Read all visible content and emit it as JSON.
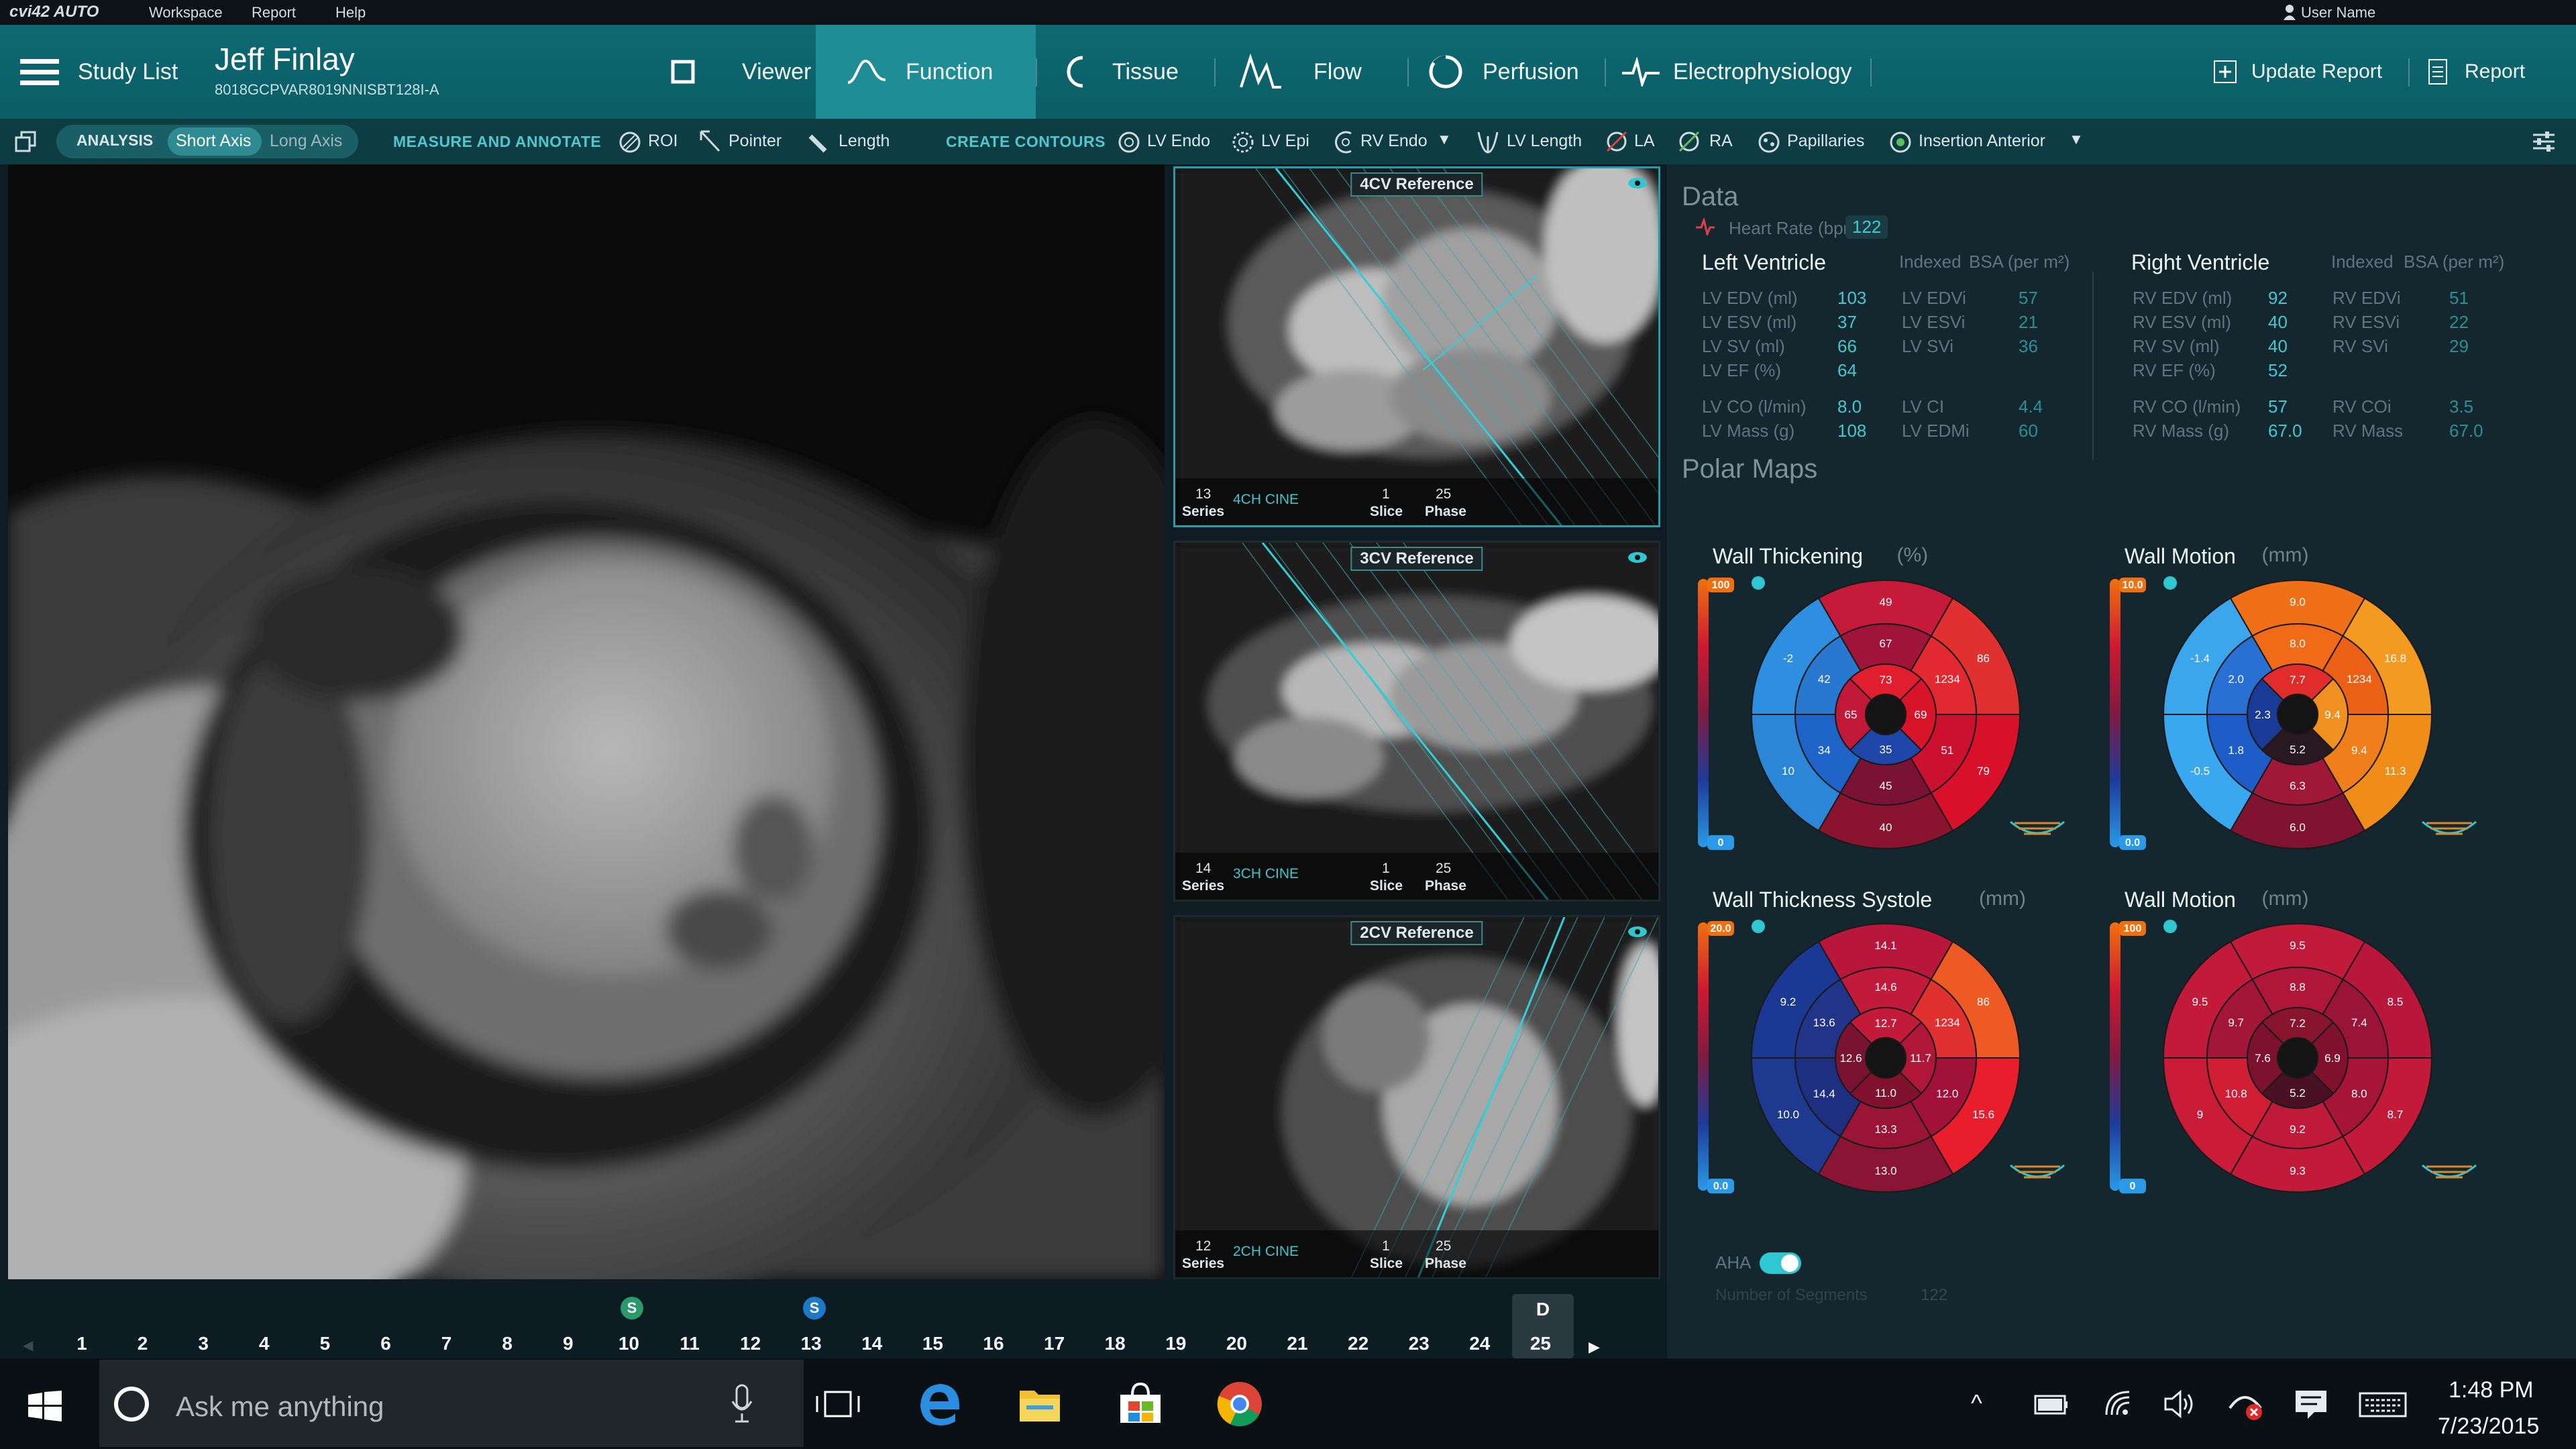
{
  "menubar": {
    "app_name": "cvi42 AUTO",
    "items": [
      "Workspace",
      "Report",
      "Help"
    ],
    "user": "User Name"
  },
  "header": {
    "study_list": "Study List",
    "patient_name": "Jeff Finlay",
    "patient_id": "8018GCPVAR8019NNISBT128I-A",
    "tabs": [
      "Viewer",
      "Function",
      "Tissue",
      "Flow",
      "Perfusion",
      "Electrophysiology"
    ],
    "active_tab": "Function",
    "update_report": "Update Report",
    "report": "Report"
  },
  "toolbar": {
    "analysis": "ANALYSIS",
    "short_axis": "Short Axis",
    "long_axis": "Long Axis",
    "measure": "MEASURE AND ANNOTATE",
    "roi": "ROI",
    "pointer": "Pointer",
    "length": "Length",
    "create": "CREATE CONTOURS",
    "lv_endo": "LV Endo",
    "lv_epi": "LV Epi",
    "rv_endo": "RV Endo",
    "lv_length": "LV Length",
    "la": "LA",
    "ra": "RA",
    "papillaries": "Papillaries",
    "insertion": "Insertion Anterior"
  },
  "references": [
    {
      "title": "4CV Reference",
      "series": "13",
      "series_label": "Series",
      "sequence": "4CH CINE",
      "slice": "1",
      "slice_label": "Slice",
      "phase": "25",
      "phase_label": "Phase"
    },
    {
      "title": "3CV Reference",
      "series": "14",
      "series_label": "Series",
      "sequence": "3CH CINE",
      "slice": "1",
      "slice_label": "Slice",
      "phase": "25",
      "phase_label": "Phase"
    },
    {
      "title": "2CV Reference",
      "series": "12",
      "series_label": "Series",
      "sequence": "2CH CINE",
      "slice": "1",
      "slice_label": "Slice",
      "phase": "25",
      "phase_label": "Phase"
    }
  ],
  "data": {
    "title": "Data",
    "heart_rate_label": "Heart Rate (bpm)",
    "heart_rate": "122",
    "lv": {
      "title": "Left Ventricle",
      "indexed": "Indexed",
      "bsa": "BSA (per m²)",
      "rows": [
        [
          "LV EDV (ml)",
          "103",
          "LV EDVi",
          "57"
        ],
        [
          "LV ESV (ml)",
          "37",
          "LV ESVi",
          "21"
        ],
        [
          "LV SV (ml)",
          "66",
          "LV SVi",
          "36"
        ],
        [
          "LV EF (%)",
          "64",
          "",
          ""
        ],
        [
          "LV CO (l/min)",
          "8.0",
          "LV CI",
          "4.4"
        ],
        [
          "LV Mass (g)",
          "108",
          "LV EDMi",
          "60"
        ]
      ]
    },
    "rv": {
      "title": "Right  Ventricle",
      "indexed": "Indexed",
      "bsa": "BSA (per m²)",
      "rows": [
        [
          "RV EDV (ml)",
          "92",
          "RV EDVi",
          "51"
        ],
        [
          "RV ESV (ml)",
          "40",
          "RV ESVi",
          "22"
        ],
        [
          "RV SV (ml)",
          "40",
          "RV SVi",
          "29"
        ],
        [
          "RV EF (%)",
          "52",
          "",
          ""
        ],
        [
          "RV CO (l/min)",
          "57",
          "RV COi",
          "3.5"
        ],
        [
          "RV Mass (g)",
          "67.0",
          "RV Mass",
          "67.0"
        ]
      ]
    },
    "polar_title": "Polar Maps",
    "maps": [
      {
        "title": "Wall Thickening",
        "unit": "(%)",
        "scale_max": "100",
        "scale_min": "0",
        "outer": [
          "49",
          "86",
          "79",
          "40",
          "10",
          "-2"
        ],
        "mid": [
          "67",
          "1234",
          "51",
          "45",
          "34",
          "42"
        ],
        "inner": [
          "73",
          "69",
          "35",
          "65"
        ],
        "outer_c": [
          "#c61a3a",
          "#e03030",
          "#d8102a",
          "#8a1430",
          "#2c86d8",
          "#2e8ee0"
        ],
        "mid_c": [
          "#a0143a",
          "#e22830",
          "#cc1030",
          "#7a1236",
          "#1e64c8",
          "#2878d0"
        ],
        "inner_c": [
          "#e01e2e",
          "#d8142a",
          "#1e46a8",
          "#c41838"
        ]
      },
      {
        "title": "Wall Motion",
        "unit": "(mm)",
        "scale_max": "10.0",
        "scale_min": "0.0",
        "outer": [
          "9.0",
          "16.8",
          "11.3",
          "6.0",
          "-0.5",
          "-1.4"
        ],
        "mid": [
          "8.0",
          "1234",
          "9.4",
          "6.3",
          "1.8",
          "2.0"
        ],
        "inner": [
          "7.7",
          "9.4",
          "5.2",
          "2.3"
        ],
        "outer_c": [
          "#f07018",
          "#f49a20",
          "#f08c18",
          "#801430",
          "#3aa8f0",
          "#3ca6ec"
        ],
        "mid_c": [
          "#f06a18",
          "#ec6016",
          "#f07e1a",
          "#a01838",
          "#1e5cc8",
          "#2870d4"
        ],
        "inner_c": [
          "#e02c2a",
          "#f09020",
          "#281820",
          "#1a3a98"
        ]
      },
      {
        "title": "Wall Thickness Systole",
        "unit": "(mm)",
        "scale_max": "20.0",
        "scale_min": "0.0",
        "outer": [
          "14.1",
          "86",
          "15.6",
          "13.0",
          "10.0",
          "9.2"
        ],
        "mid": [
          "14.6",
          "1234",
          "12.0",
          "13.3",
          "14.4",
          "13.6"
        ],
        "inner": [
          "12.7",
          "11.7",
          "11.0",
          "12.6"
        ],
        "outer_c": [
          "#b8163a",
          "#ee5a24",
          "#e81e2c",
          "#8a1434",
          "#1e3a90",
          "#1a3894"
        ],
        "mid_c": [
          "#c21a3a",
          "#e03030",
          "#a21238",
          "#9a1436",
          "#1e2e80",
          "#22348a"
        ],
        "inner_c": [
          "#c41a3a",
          "#b0163a",
          "#80122e",
          "#7a1232"
        ]
      },
      {
        "title": "Wall Motion",
        "unit": "(mm)",
        "scale_max": "100",
        "scale_min": "0",
        "outer": [
          "9.5",
          "8.5",
          "8.7",
          "9.3",
          "9",
          "9.5"
        ],
        "mid": [
          "8.8",
          "7.4",
          "8.0",
          "9.2",
          "10.8",
          "9.7"
        ],
        "inner": [
          "7.2",
          "6.9",
          "5.2",
          "7.6"
        ],
        "outer_c": [
          "#c21a3a",
          "#b8163a",
          "#c41a3a",
          "#c41a3a",
          "#ca1c38",
          "#c41a3a"
        ],
        "mid_c": [
          "#b0163a",
          "#9a1438",
          "#a61438",
          "#c01a3a",
          "#d01e34",
          "#a41638"
        ],
        "inner_c": [
          "#88142e",
          "#80122e",
          "#4a1024",
          "#7c122e"
        ]
      }
    ],
    "aha": "AHA",
    "segments_label": "Number of Segments",
    "segments": "122"
  },
  "timeline": {
    "frames": [
      "1",
      "2",
      "3",
      "4",
      "5",
      "6",
      "7",
      "8",
      "9",
      "10",
      "11",
      "12",
      "13",
      "14",
      "15",
      "16",
      "17",
      "18",
      "19",
      "20",
      "21",
      "22",
      "23",
      "24",
      "25"
    ],
    "s_marker": "S",
    "d_marker": "D"
  },
  "taskbar": {
    "search_placeholder": "Ask me anything",
    "time": "1:48 PM",
    "date": "7/23/2015"
  }
}
